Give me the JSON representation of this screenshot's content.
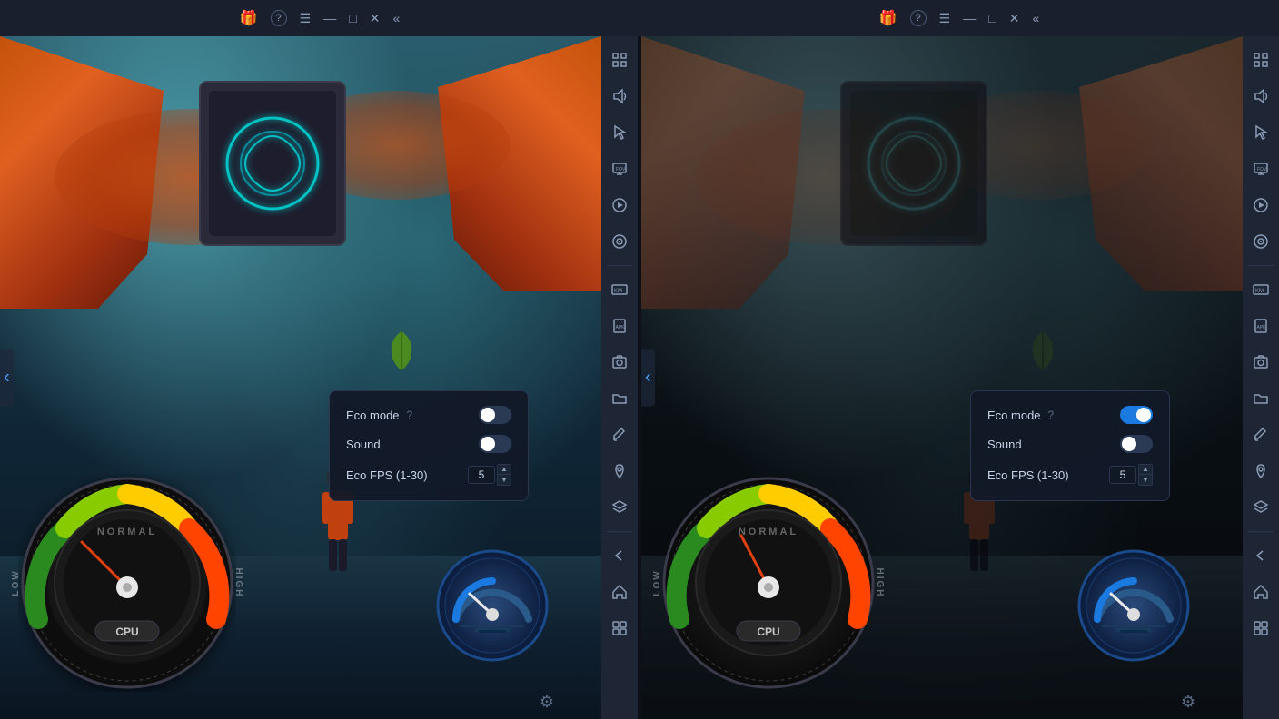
{
  "titlebar": {
    "gift_icon": "🎁",
    "help_icon": "?",
    "menu_icon": "☰",
    "minimize_icon": "—",
    "maximize_icon": "□",
    "close_icon": "✕",
    "collapse_icon": "«"
  },
  "sidebar": {
    "items": [
      {
        "icon": "⛶",
        "name": "fullscreen",
        "label": "Fullscreen"
      },
      {
        "icon": "🔊",
        "name": "sound",
        "label": "Sound"
      },
      {
        "icon": "⌖",
        "name": "cursor",
        "label": "Cursor"
      },
      {
        "icon": "🖥",
        "name": "display",
        "label": "Display"
      },
      {
        "icon": "▷",
        "name": "play",
        "label": "Play"
      },
      {
        "icon": "⊙",
        "name": "target",
        "label": "Target"
      },
      {
        "icon": "⌨",
        "name": "keyboard",
        "label": "Keyboard"
      },
      {
        "icon": "⬆",
        "name": "apk",
        "label": "APK"
      },
      {
        "icon": "📷",
        "name": "screenshot",
        "label": "Screenshot"
      },
      {
        "icon": "📁",
        "name": "folder",
        "label": "Folder"
      },
      {
        "icon": "✏",
        "name": "edit",
        "label": "Edit"
      },
      {
        "icon": "📍",
        "name": "location",
        "label": "Location"
      },
      {
        "icon": "⬡",
        "name": "layers",
        "label": "Layers"
      },
      {
        "icon": "←",
        "name": "back",
        "label": "Back"
      },
      {
        "icon": "⌂",
        "name": "home",
        "label": "Home"
      },
      {
        "icon": "⧉",
        "name": "apps",
        "label": "Apps"
      }
    ]
  },
  "panel_left": {
    "eco_popup": {
      "title": "Eco mode",
      "sound_label": "Sound",
      "fps_label": "Eco FPS (1-30)",
      "fps_value": "5",
      "eco_enabled": false,
      "sound_enabled": false
    },
    "gauge": {
      "label": "CPU",
      "normal_text": "NORMAL",
      "low_text": "LOW",
      "high_text": "HIGH"
    }
  },
  "panel_right": {
    "eco_popup": {
      "title": "Eco mode",
      "sound_label": "Sound",
      "fps_label": "Eco FPS (1-30)",
      "fps_value": "5",
      "eco_enabled": true,
      "sound_enabled": false
    },
    "gauge": {
      "label": "CPU",
      "normal_text": "NORMAL",
      "low_text": "LOW",
      "high_text": "HIGH"
    }
  }
}
